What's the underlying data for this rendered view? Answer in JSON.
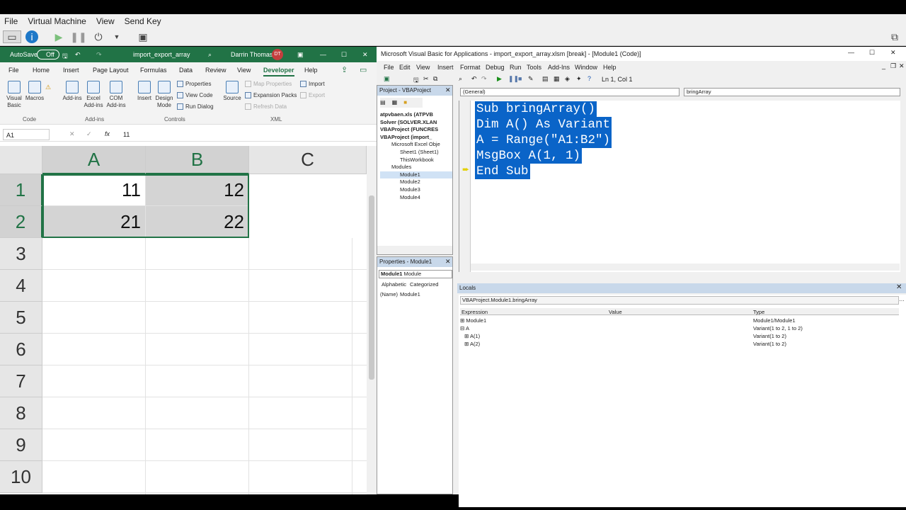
{
  "vm": {
    "menu": [
      "File",
      "Virtual Machine",
      "View",
      "Send Key"
    ]
  },
  "excel": {
    "autosave": "AutoSave",
    "autosave_state": "Off",
    "filename": "import_export_array",
    "user": "Darrin Thomas",
    "initials": "DT",
    "tabs": [
      "File",
      "Home",
      "Insert",
      "Page Layout",
      "Formulas",
      "Data",
      "Review",
      "View",
      "Developer",
      "Help"
    ],
    "active_tab": "Developer",
    "ribbon": {
      "visual_basic": "Visual Basic",
      "macros": "Macros",
      "add_ins": "Add-ins",
      "excel_add_ins": "Excel Add-ins",
      "com_add_ins": "COM Add-ins",
      "insert": "Insert",
      "design_mode": "Design Mode",
      "properties": "Properties",
      "view_code": "View Code",
      "run_dialog": "Run Dialog",
      "source": "Source",
      "map_properties": "Map Properties",
      "expansion_packs": "Expansion Packs",
      "refresh_data": "Refresh Data",
      "import": "Import",
      "export": "Export",
      "groups": {
        "code": "Code",
        "add_ins": "Add-ins",
        "controls": "Controls",
        "xml": "XML"
      }
    },
    "namebox": "A1",
    "formula": "11",
    "columns": [
      "A",
      "B",
      "C"
    ],
    "rows": [
      "1",
      "2",
      "3",
      "4",
      "5",
      "6",
      "7",
      "8",
      "9",
      "10"
    ],
    "cells": {
      "a1": "11",
      "b1": "12",
      "a2": "21",
      "b2": "22"
    }
  },
  "vbe": {
    "title": "Microsoft Visual Basic for Applications - import_export_array.xlsm [break] - [Module1 (Code)]",
    "menu": [
      "File",
      "Edit",
      "View",
      "Insert",
      "Format",
      "Debug",
      "Run",
      "Tools",
      "Add-Ins",
      "Window",
      "Help"
    ],
    "position": "Ln 1, Col 1",
    "project": {
      "title": "Project - VBAProject",
      "items": [
        "atpvbaen.xls (ATPVB",
        "Solver (SOLVER.XLAN",
        "VBAProject (FUNCRES",
        "VBAProject (import_",
        "Microsoft Excel Obje",
        "Sheet1 (Sheet1)",
        "ThisWorkbook",
        "Modules",
        "Module1",
        "Module2",
        "Module3",
        "Module4"
      ]
    },
    "properties": {
      "title": "Properties - Module1",
      "object": "Module1",
      "object_type": "Module",
      "tab_alpha": "Alphabetic",
      "tab_cat": "Categorized",
      "name_key": "(Name)",
      "name_val": "Module1"
    },
    "object_dropdown": "(General)",
    "proc_dropdown": "bringArray",
    "code": [
      "Sub bringArray()",
      "Dim A() As Variant",
      "A = Range(\"A1:B2\")",
      "MsgBox A(1, 1)",
      "End Sub"
    ],
    "locals": {
      "title": "Locals",
      "context": "VBAProject.Module1.bringArray",
      "headers": [
        "Expression",
        "Value",
        "Type"
      ],
      "rows": [
        {
          "expr": "Module1",
          "type": "Module1/Module1"
        },
        {
          "expr": "A",
          "type": "Variant(1 to 2, 1 to 2)"
        },
        {
          "expr": "A(1)",
          "type": "Variant(1 to 2)"
        },
        {
          "expr": "A(2)",
          "type": "Variant(1 to 2)"
        }
      ]
    }
  }
}
